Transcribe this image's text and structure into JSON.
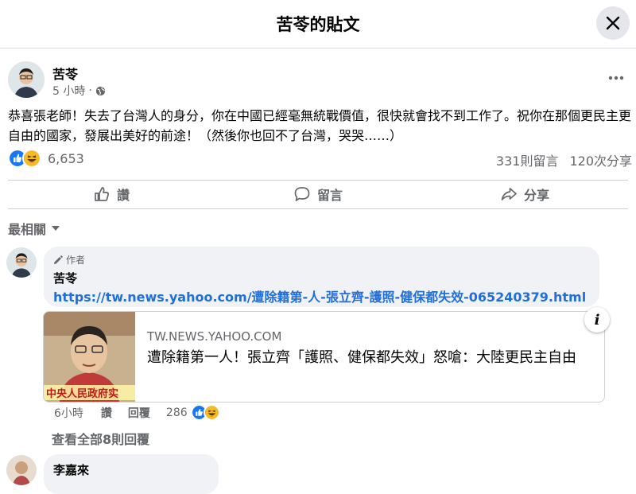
{
  "header": {
    "title": "苦苓的貼文",
    "close_icon": "close-icon"
  },
  "post": {
    "author": "苦苓",
    "time": "5 小時",
    "separator": "·",
    "privacy_icon": "globe-icon",
    "text": "恭喜張老師！失去了台灣人的身分，你在中國已經毫無統戰價值，很快就會找不到工作了。祝你在那個更民主更自由的國家，發展出美好的前途！（然後你也回不了台灣，哭哭……）",
    "reaction_count": "6,653",
    "reactions": [
      "like",
      "haha"
    ],
    "comments_count": "331則留言",
    "shares_count": "120次分享"
  },
  "actions": {
    "like": "讚",
    "comment": "留言",
    "share": "分享"
  },
  "sort_label": "最相關",
  "comment": {
    "badge": "作者",
    "author": "苦苓",
    "link": "https://tw.news.yahoo.com/遭除籍第-人-張立齊-護照-健保都失效-065240379.html",
    "preview": {
      "domain": "TW.NEWS.YAHOO.COM",
      "headline": "遭除籍第一人！張立齊「護照、健保都失效」怒嗆：大陸更民主自由",
      "thumb_caption": "中央人民政府实"
    },
    "time": "6小時",
    "like": "讚",
    "reply": "回覆",
    "reaction_count": "286",
    "view_replies": "查看全部8則回覆"
  },
  "next_comment": {
    "author": "李嘉來"
  },
  "colors": {
    "link": "#216fdb",
    "muted": "#65676b",
    "like_blue": "#1877f2",
    "haha_yellow": "#f7b928"
  }
}
